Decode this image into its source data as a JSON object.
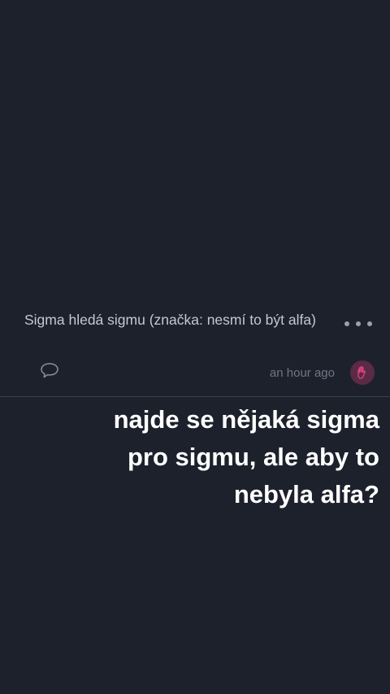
{
  "post": {
    "text": "Sigma hledá sigmu (značka: nesmí to být alfa)",
    "timestamp": "an hour ago",
    "comment_icon": "speech-bubble-icon",
    "more_icon": "ellipsis-icon",
    "reaction_icon": "hand-icon",
    "reaction_color": "#e0447f"
  },
  "overlay": {
    "lines": [
      "najde se nějaká sigma",
      "pro sigmu, ale aby to",
      "nebyla alfa?"
    ]
  },
  "colors": {
    "background": "#1c212c",
    "post_text": "#c3c8d1",
    "muted": "#6f7685",
    "caption": "#ffffff"
  }
}
